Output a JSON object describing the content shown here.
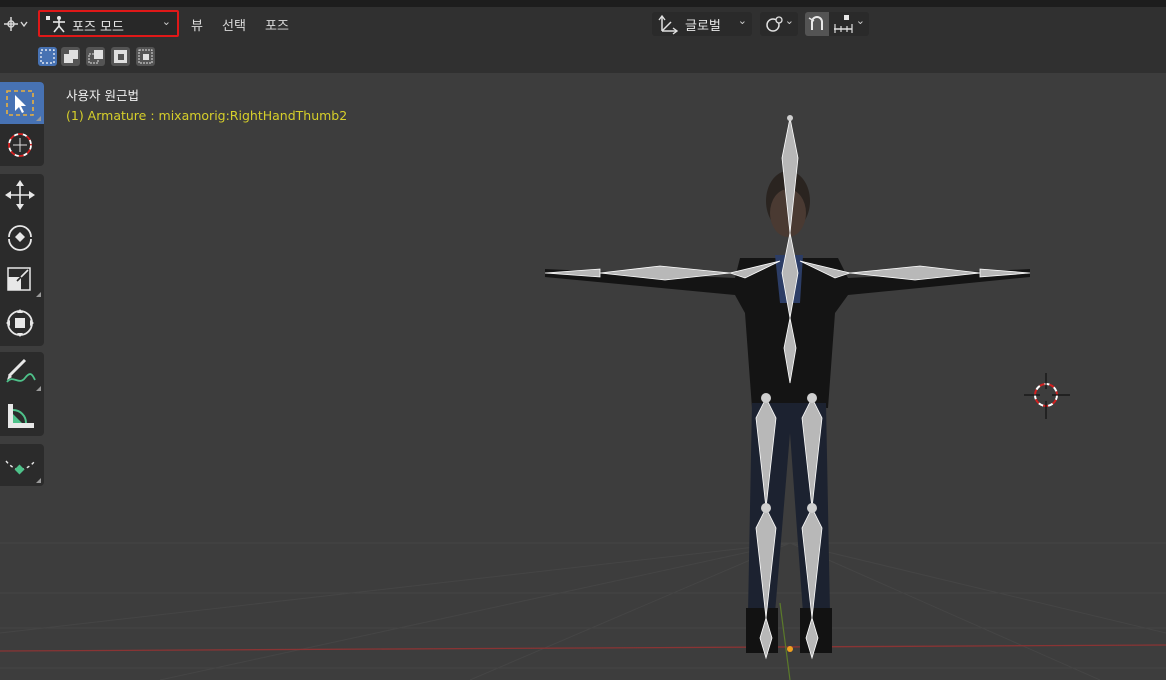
{
  "header": {
    "mode_label": "포즈 모드",
    "menus": [
      "뷰",
      "선택",
      "포즈"
    ],
    "transform_orientation": "글로벌"
  },
  "viewport": {
    "view_title": "사용자 원근법",
    "object_info": "(1) Armature : mixamorig:RightHandThumb2"
  },
  "toolbar": {
    "tools": [
      "select-box-tool",
      "cursor-tool",
      "move-tool",
      "rotate-tool",
      "scale-tool",
      "transform-tool",
      "annotate-tool",
      "measure-tool",
      "relax-tool"
    ]
  },
  "colors": {
    "highlight_box": "#e01818",
    "active_tool": "#4772b3",
    "object_info_text": "#d6cf2a"
  }
}
